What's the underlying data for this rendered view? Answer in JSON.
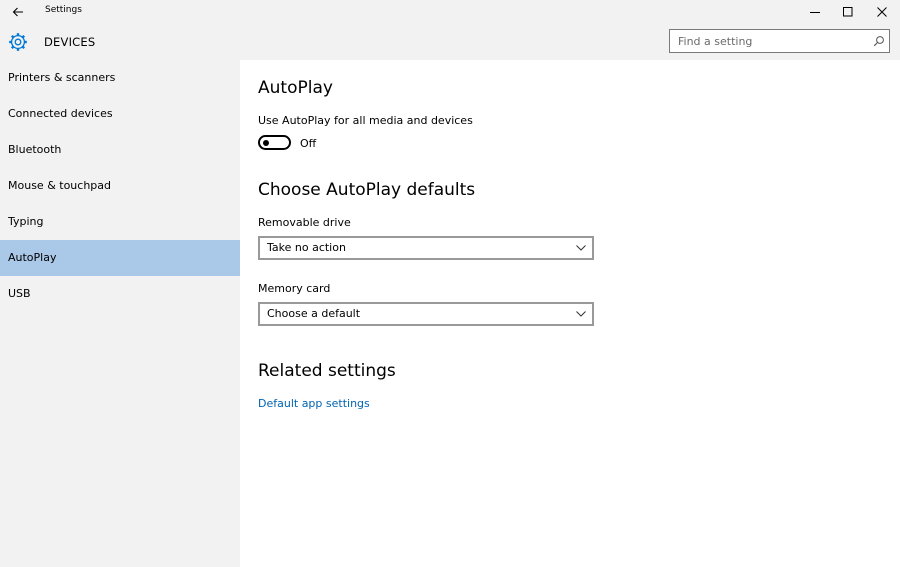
{
  "window": {
    "title": "Settings",
    "back_icon": "back-arrow-icon",
    "minimize_icon": "minimize-icon",
    "maximize_icon": "maximize-icon",
    "close_icon": "close-icon"
  },
  "header": {
    "icon": "gear-icon",
    "title": "DEVICES",
    "search": {
      "placeholder": "Find a setting",
      "icon": "search-icon"
    }
  },
  "sidebar": {
    "items": [
      {
        "label": "Printers & scanners",
        "active": false
      },
      {
        "label": "Connected devices",
        "active": false
      },
      {
        "label": "Bluetooth",
        "active": false
      },
      {
        "label": "Mouse & touchpad",
        "active": false
      },
      {
        "label": "Typing",
        "active": false
      },
      {
        "label": "AutoPlay",
        "active": true
      },
      {
        "label": "USB",
        "active": false
      }
    ]
  },
  "main": {
    "autoplay_heading": "AutoPlay",
    "toggle_label": "Use AutoPlay for all media and devices",
    "toggle_state": "Off",
    "defaults_heading": "Choose AutoPlay defaults",
    "removable": {
      "label": "Removable drive",
      "value": "Take no action"
    },
    "memory": {
      "label": "Memory card",
      "value": "Choose a default"
    },
    "related_heading": "Related settings",
    "related_link": "Default app settings"
  },
  "colors": {
    "chrome_bg": "#f2f2f2",
    "active_nav": "#aac8e8",
    "link": "#0063b1",
    "accent": "#0078d7"
  }
}
